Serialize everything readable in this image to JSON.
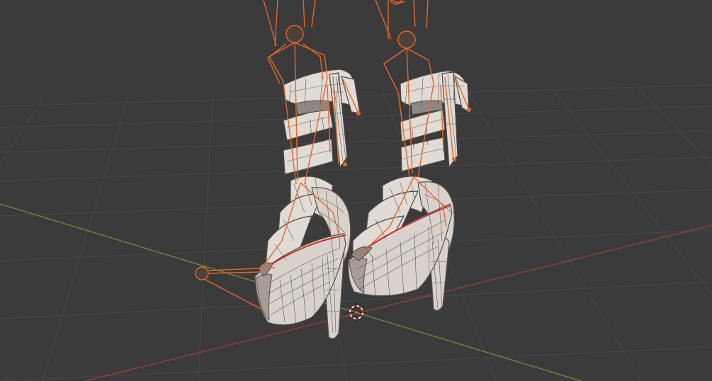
{
  "viewport": {
    "background": "#3b3b3b",
    "grid_color": "#474747",
    "axis_x_color": "#9a4040",
    "axis_y_color": "#6f8f3a"
  },
  "scene": {
    "objects": [
      {
        "name": "left-platform-heel-mesh"
      },
      {
        "name": "right-platform-heel-mesh"
      },
      {
        "name": "armature"
      }
    ],
    "mesh_color": "#d9d2cc",
    "bone_color": "#e5672c",
    "seam_color": "#c0342a"
  },
  "cursor_icon": "3d-cursor-icon"
}
